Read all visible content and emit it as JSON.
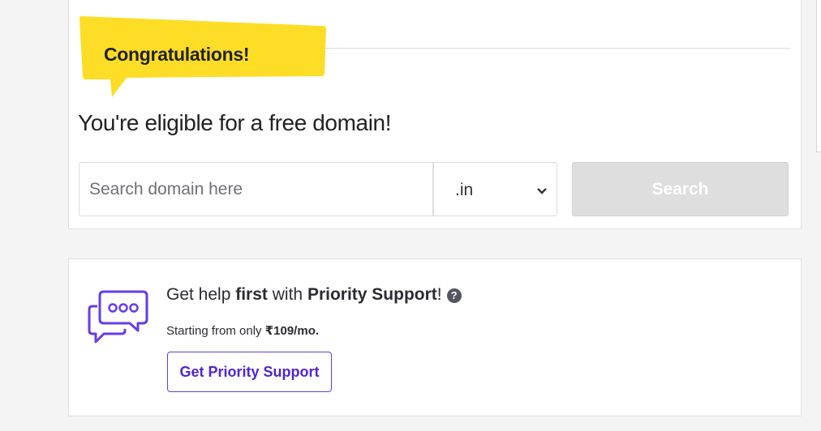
{
  "domain_offer": {
    "ribbon_text": "Congratulations!",
    "title": "You're eligible for a free domain!",
    "search_placeholder": "Search domain here",
    "search_value": "",
    "tld_selected": ".in",
    "search_button": "Search"
  },
  "priority_support": {
    "line_pre": "Get help ",
    "line_bold1": "first",
    "line_mid": " with ",
    "line_bold2": "Priority Support",
    "line_post": "!",
    "help_glyph": "?",
    "price_pre": "Starting from only ",
    "price_value": "₹109/mo.",
    "button_label": "Get Priority Support"
  },
  "icons": {
    "ribbon": "speech-ribbon-icon",
    "chevron": "chevron-down-icon",
    "chat": "chat-bubbles-icon",
    "help": "help-circle-icon"
  },
  "colors": {
    "ribbon_yellow": "#fedd26",
    "accent_purple": "#673de6",
    "button_disabled": "#dedede"
  }
}
